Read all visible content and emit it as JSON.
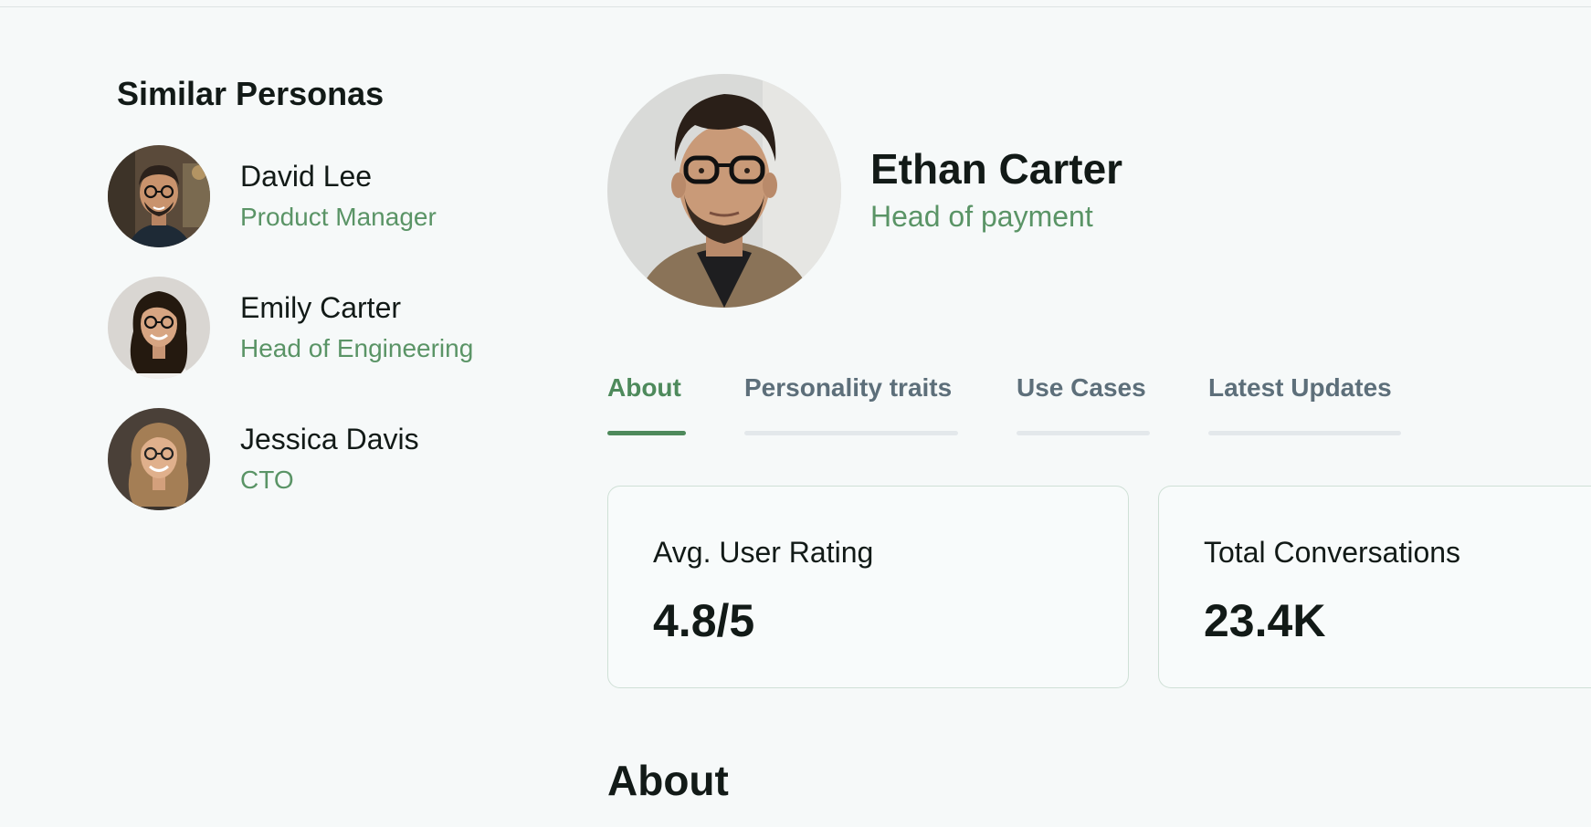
{
  "sidebar": {
    "title": "Similar Personas",
    "personas": [
      {
        "name": "David Lee",
        "role": "Product Manager"
      },
      {
        "name": "Emily Carter",
        "role": "Head of Engineering"
      },
      {
        "name": "Jessica Davis",
        "role": "CTO"
      }
    ]
  },
  "profile": {
    "name": "Ethan Carter",
    "role": "Head of payment"
  },
  "tabs": [
    {
      "label": "About",
      "active": true
    },
    {
      "label": "Personality traits",
      "active": false
    },
    {
      "label": "Use Cases",
      "active": false
    },
    {
      "label": "Latest Updates",
      "active": false
    }
  ],
  "stats": [
    {
      "label": "Avg. User Rating",
      "value": "4.8/5"
    },
    {
      "label": "Total Conversations",
      "value": "23.4K"
    }
  ],
  "section": {
    "title": "About"
  },
  "colors": {
    "accent": "#4e8a5c",
    "role_text": "#5a9466",
    "background": "#f6f9f9",
    "card_border": "#cfe0d6",
    "inactive_tab": "#5d6f7a"
  }
}
